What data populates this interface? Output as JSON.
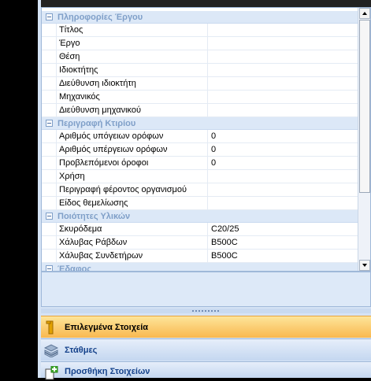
{
  "grid": {
    "categories": [
      {
        "title": "Πληροφορίες Έργου",
        "rows": [
          {
            "label": "Τίτλος",
            "value": ""
          },
          {
            "label": "Έργο",
            "value": ""
          },
          {
            "label": "Θέση",
            "value": ""
          },
          {
            "label": "Ιδιοκτήτης",
            "value": ""
          },
          {
            "label": "Διεύθυνση ιδιοκτήτη",
            "value": ""
          },
          {
            "label": "Μηχανικός",
            "value": ""
          },
          {
            "label": "Διεύθυνση μηχανικού",
            "value": ""
          }
        ]
      },
      {
        "title": "Περιγραφή Κτιρίου",
        "rows": [
          {
            "label": "Αριθμός υπόγειων ορόφων",
            "value": "0"
          },
          {
            "label": "Αριθμός υπέργειων ορόφων",
            "value": "0"
          },
          {
            "label": "Προβλεπόμενοι όροφοι",
            "value": "0"
          },
          {
            "label": "Χρήση",
            "value": ""
          },
          {
            "label": "Περιγραφή φέροντος οργανισμού",
            "value": ""
          },
          {
            "label": "Είδος θεμελίωσης",
            "value": ""
          }
        ]
      },
      {
        "title": "Ποιότητες Υλικών",
        "rows": [
          {
            "label": "Σκυρόδεμα",
            "value": "C20/25"
          },
          {
            "label": "Χάλυβας Ράβδων",
            "value": "B500C"
          },
          {
            "label": "Χάλυβας Συνδετήρων",
            "value": "B500C"
          }
        ]
      },
      {
        "title": "Έδαφος",
        "rows": []
      }
    ]
  },
  "nav": {
    "selected": "Επιλεγμένα Στοιχεία",
    "levels": "Στάθμες",
    "add": "Προσθήκη Στοιχείων"
  },
  "colors": {
    "category_text": "#7f9fc8",
    "selected_bar": "#f9b84f",
    "nav_text": "#15428b"
  }
}
